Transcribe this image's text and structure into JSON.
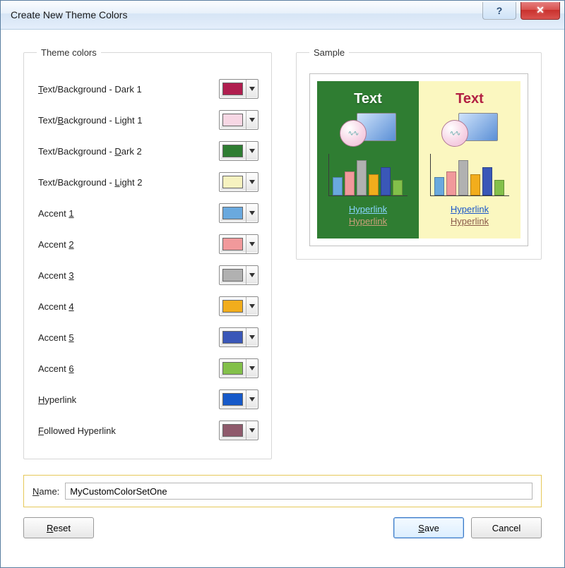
{
  "window": {
    "title": "Create New Theme Colors"
  },
  "groups": {
    "theme_colors": "Theme colors",
    "sample": "Sample"
  },
  "theme_colors": [
    {
      "label_pre": "",
      "u": "T",
      "label_post": "ext/Background - Dark 1",
      "color": "#b01e4f"
    },
    {
      "label_pre": "Text/",
      "u": "B",
      "label_post": "ackground - Light 1",
      "color": "#f7d7e4"
    },
    {
      "label_pre": "Text/Background - ",
      "u": "D",
      "label_post": "ark 2",
      "color": "#2f7d32"
    },
    {
      "label_pre": "Text/Background - ",
      "u": "L",
      "label_post": "ight 2",
      "color": "#f6f2c0"
    },
    {
      "label_pre": "Accent ",
      "u": "1",
      "label_post": "",
      "color": "#6aa9de"
    },
    {
      "label_pre": "Accent ",
      "u": "2",
      "label_post": "",
      "color": "#f1999b"
    },
    {
      "label_pre": "Accent ",
      "u": "3",
      "label_post": "",
      "color": "#b1b1b1"
    },
    {
      "label_pre": "Accent ",
      "u": "4",
      "label_post": "",
      "color": "#f2ad1c"
    },
    {
      "label_pre": "Accent ",
      "u": "5",
      "label_post": "",
      "color": "#3a57b8"
    },
    {
      "label_pre": "Accent ",
      "u": "6",
      "label_post": "",
      "color": "#83c04a"
    },
    {
      "label_pre": "",
      "u": "H",
      "label_post": "yperlink",
      "color": "#1659c9"
    },
    {
      "label_pre": "",
      "u": "F",
      "label_post": "ollowed Hyperlink",
      "color": "#8f5a6c"
    }
  ],
  "sample": {
    "heading": "Text",
    "hyperlink": "Hyperlink",
    "followed": "Hyperlink",
    "bars": [
      {
        "h": 26,
        "c": "#6aa9de"
      },
      {
        "h": 34,
        "c": "#f1999b"
      },
      {
        "h": 50,
        "c": "#b1b1b1"
      },
      {
        "h": 30,
        "c": "#f2ad1c"
      },
      {
        "h": 40,
        "c": "#3a57b8"
      },
      {
        "h": 22,
        "c": "#83c04a"
      }
    ]
  },
  "name": {
    "label_pre": "",
    "u": "N",
    "label_post": "ame:",
    "value": "MyCustomColorSetOne"
  },
  "buttons": {
    "reset": {
      "pre": "",
      "u": "R",
      "post": "eset"
    },
    "save": {
      "pre": "",
      "u": "S",
      "post": "ave"
    },
    "cancel": {
      "pre": "Cancel",
      "u": "",
      "post": ""
    }
  }
}
